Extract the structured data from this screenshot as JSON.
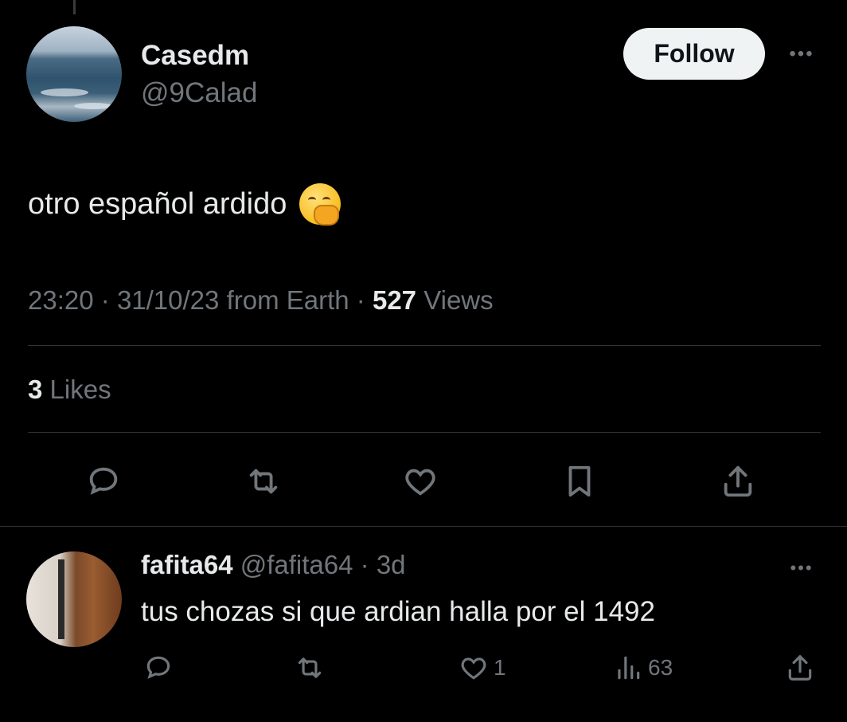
{
  "tweet": {
    "display_name": "Casedm",
    "handle": "@9Calad",
    "follow_label": "Follow",
    "more_label": "•••",
    "text": "otro español ardido",
    "emoji": "face-with-hand-over-mouth",
    "time": "23:20",
    "date": "31/10/23",
    "source": "from Earth",
    "views_count": "527",
    "views_label": "Views",
    "likes_count": "3",
    "likes_label": "Likes",
    "actions": [
      "reply-icon",
      "retweet-icon",
      "like-icon",
      "bookmark-icon",
      "share-icon"
    ]
  },
  "reply": {
    "display_name": "fafita64",
    "handle": "@fafita64",
    "age": "3d",
    "text": "tus chozas si que ardian halla por el 1492",
    "more_label": "•••",
    "like_count": "1",
    "views_count": "63"
  },
  "colors": {
    "background": "#000000",
    "text_primary": "#e7e9ea",
    "text_secondary": "#71767b",
    "divider": "#2f3336",
    "follow_bg": "#eff3f4"
  }
}
